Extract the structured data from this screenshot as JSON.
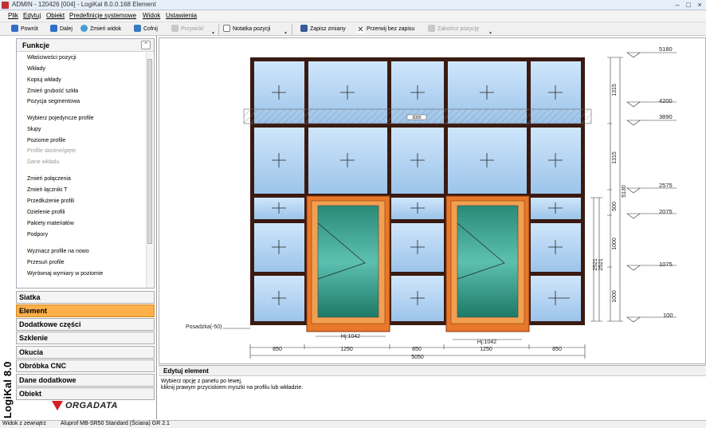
{
  "window": {
    "title": "ADMIN - 120426 [004] - LogiKal 8.0.0.168 Element"
  },
  "menu": [
    "Plik",
    "Edytuj",
    "Obiekt",
    "Predefinicje systemowe",
    "Widok",
    "Ustawienia"
  ],
  "toolbar": {
    "back": "Powrót",
    "forward": "Dalej",
    "change_view": "Zmień widok",
    "undo": "Cofnij",
    "redo": "Przywróć",
    "note": "Notatka pozycji",
    "save": "Zapisz zmiany",
    "abort": "Przerwij bez zapisu",
    "finish": "Zakończ pozycję"
  },
  "functions": {
    "title": "Funkcje",
    "items": [
      {
        "label": "Właściwości pozycji",
        "enabled": true
      },
      {
        "label": "Wkłady",
        "enabled": true
      },
      {
        "label": "Kopiuj wkłady",
        "enabled": true
      },
      {
        "label": "Zmień grubość szkła",
        "enabled": true
      },
      {
        "label": "Pozycja segmentowa",
        "enabled": true
      },
      {
        "label": "Wybierz pojedyncze profile",
        "enabled": true
      },
      {
        "label": "Słupy",
        "enabled": true
      },
      {
        "label": "Poziome profile",
        "enabled": true
      },
      {
        "label": "Profile skośne/gięte",
        "enabled": false
      },
      {
        "label": "Dane wkładu",
        "enabled": false
      },
      {
        "label": "Zmień połączenia",
        "enabled": true
      },
      {
        "label": "Zmień łączniki T",
        "enabled": true
      },
      {
        "label": "Przedłużenie profili",
        "enabled": true
      },
      {
        "label": "Dzielenie profili",
        "enabled": true
      },
      {
        "label": "Pakiety materiałów",
        "enabled": true
      },
      {
        "label": "Podpory",
        "enabled": true
      },
      {
        "label": "Wyznacz profile na nowo",
        "enabled": true
      },
      {
        "label": "Przesuń profile",
        "enabled": true
      },
      {
        "label": "Wyrównaj wymiary w poziomie",
        "enabled": true
      }
    ]
  },
  "categories": [
    {
      "label": "Siatka",
      "active": false
    },
    {
      "label": "Element",
      "active": true
    },
    {
      "label": "Dodatkowe części",
      "active": false
    },
    {
      "label": "Szklenie",
      "active": false
    },
    {
      "label": "Okucia",
      "active": false
    },
    {
      "label": "Obróbka CNC",
      "active": false
    },
    {
      "label": "Dane dodatkowe",
      "active": false
    },
    {
      "label": "Obiekt",
      "active": false
    }
  ],
  "brand": {
    "vertical": "LogiKal 8.0",
    "logo": "ORGADATA"
  },
  "drawing": {
    "floor_label": "Posadzka(-50)",
    "door_labels": [
      "Hj:1042",
      "Hj:1042"
    ],
    "bottom_dims": [
      "850",
      "1250",
      "850",
      "1250",
      "850"
    ],
    "total_width": "5050",
    "levels": [
      "5180",
      "4200",
      "3890",
      "2575",
      "2075",
      "1075",
      "100"
    ],
    "right_dims": [
      "1315",
      "1315",
      "500",
      "1000",
      "1000"
    ],
    "total_height": "5130",
    "door_heights": [
      "2521",
      "2521"
    ],
    "beam_label": "0000"
  },
  "info": {
    "title": "Edytuj element",
    "line1": "Wybierz opcję z panelu po lewej,",
    "line2": "kliknij prawym przyciskiem myszki na profilu lub wkładzie."
  },
  "status": {
    "left": "Widok z zewnątrz",
    "right": "Aluprof MB-SR50 Standard (Ściana) GR 2.1"
  }
}
